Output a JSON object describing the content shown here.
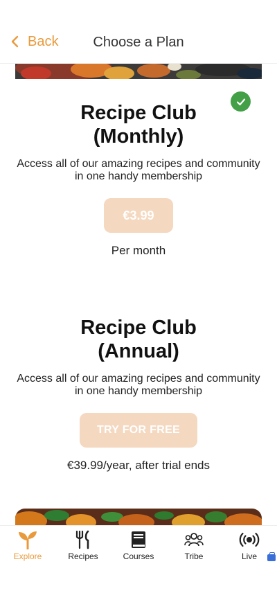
{
  "header": {
    "back_label": "Back",
    "title": "Choose a Plan"
  },
  "plans": [
    {
      "title_line1": "Recipe Club",
      "title_line2": "(Monthly)",
      "description": "Access all of our amazing recipes and community in one handy membership",
      "button_label": "€3.99",
      "note": "Per month",
      "selected": true
    },
    {
      "title_line1": "Recipe Club",
      "title_line2": "(Annual)",
      "description": "Access all of our amazing recipes and community in one handy membership",
      "button_label": "TRY FOR FREE",
      "note": "€39.99/year, after trial ends",
      "selected": false
    }
  ],
  "tabs": [
    {
      "label": "Explore",
      "icon": "sprout-icon",
      "active": true
    },
    {
      "label": "Recipes",
      "icon": "fork-knife-icon",
      "active": false
    },
    {
      "label": "Courses",
      "icon": "book-icon",
      "active": false
    },
    {
      "label": "Tribe",
      "icon": "people-icon",
      "active": false
    },
    {
      "label": "Live",
      "icon": "broadcast-icon",
      "active": false
    }
  ],
  "colors": {
    "accent": "#e89a3c",
    "button_bg": "#f4d8c0",
    "check_green": "#43a047"
  }
}
